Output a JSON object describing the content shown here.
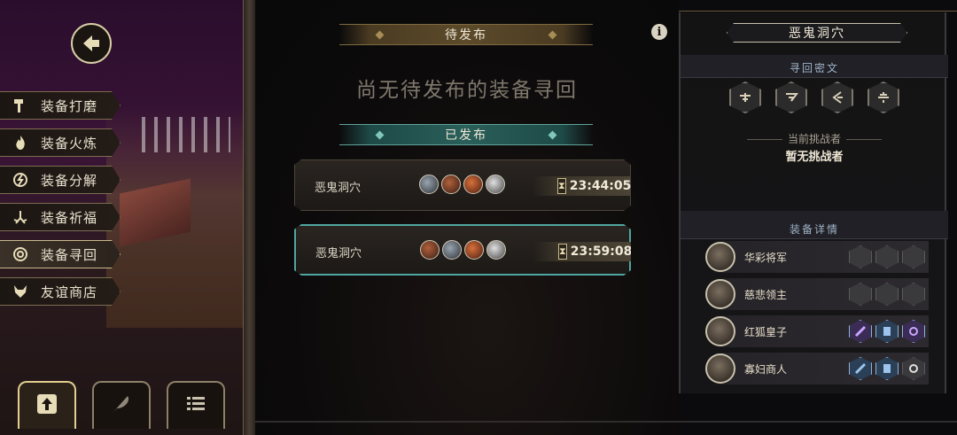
{
  "left_menu": {
    "items": [
      {
        "label": "装备打磨",
        "icon": "hammer-icon"
      },
      {
        "label": "装备火炼",
        "icon": "flame-icon"
      },
      {
        "label": "装备分解",
        "icon": "break-icon"
      },
      {
        "label": "装备祈福",
        "icon": "blessing-icon"
      },
      {
        "label": "装备寻回",
        "icon": "target-icon"
      },
      {
        "label": "友谊商店",
        "icon": "fox-icon"
      }
    ],
    "active_index": 4
  },
  "bottom_buttons": [
    {
      "icon": "publish-icon"
    },
    {
      "icon": "feather-icon"
    },
    {
      "icon": "list-icon"
    }
  ],
  "center": {
    "pending_title": "待发布",
    "empty_message": "尚无待发布的装备寻回",
    "published_title": "已发布",
    "info_symbol": "i",
    "quests": [
      {
        "name": "恶鬼洞穴",
        "time": "23:44:05",
        "avatars": [
          "a1",
          "a2",
          "a3",
          "a4"
        ]
      },
      {
        "name": "恶鬼洞穴",
        "time": "23:59:08",
        "avatars": [
          "a2",
          "a1",
          "a3",
          "a4"
        ]
      }
    ],
    "selected_quest": 1
  },
  "right": {
    "dungeon_title": "恶鬼洞穴",
    "riddle_title": "寻回密文",
    "challenger_label": "当前挑战者",
    "challenger_value": "暂无挑战者",
    "gear_title": "装备详情",
    "gear_rows": [
      {
        "name": "华彩将军",
        "slots": [
          false,
          false,
          false
        ]
      },
      {
        "name": "慈悲领主",
        "slots": [
          false,
          false,
          false
        ]
      },
      {
        "name": "红狐皇子",
        "slots": [
          true,
          true,
          true
        ]
      },
      {
        "name": "寡妇商人",
        "slots": [
          true,
          true,
          true
        ]
      }
    ]
  },
  "colors": {
    "accent_gold": "#c9b98d",
    "accent_teal": "#4fa6a0",
    "left_bg_purple": "#3a1437"
  }
}
